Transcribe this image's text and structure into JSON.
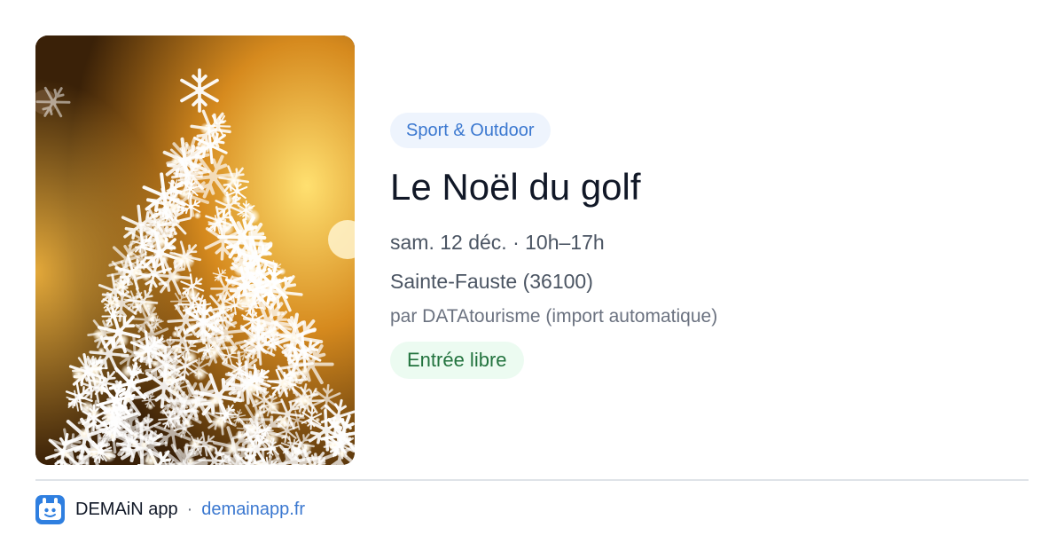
{
  "event": {
    "category": "Sport & Outdoor",
    "title": "Le Noël du golf",
    "datetime": "sam. 12 déc. · 10h–17h",
    "location": "Sainte-Fauste (36100)",
    "source": "par DATAtourisme (import automatique)",
    "price": "Entrée libre"
  },
  "footer": {
    "app_name": "DEMAiN app",
    "separator": "·",
    "domain": "demainapp.fr"
  },
  "colors": {
    "accent": "#3b78d0",
    "category_bg": "#eef4fd",
    "price_text": "#22733e",
    "price_bg": "#ecfbf1"
  }
}
